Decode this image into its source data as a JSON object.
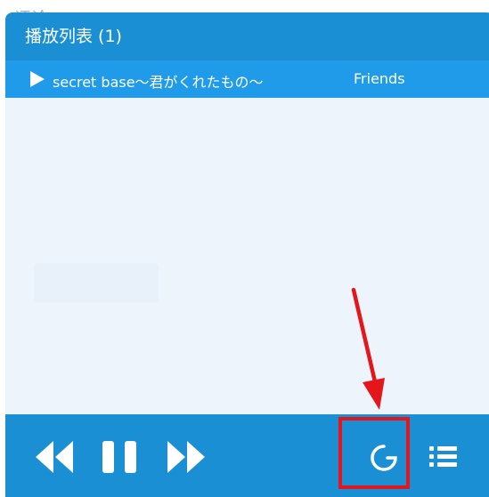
{
  "background": {
    "label": "评论"
  },
  "playlist": {
    "title": "播放列表 (1)",
    "tracks": [
      {
        "title": "secret base～君がくれたもの～",
        "artist": "Friends",
        "active": true
      }
    ]
  },
  "controls": {
    "icons": [
      "rewind-icon",
      "pause-icon",
      "fast-forward-icon",
      "loop-mode-icon",
      "playlist-icon"
    ]
  },
  "annotation": {
    "color": "#e4161c"
  },
  "colors": {
    "panel": "#1b8fd4",
    "active_row": "#1f9bea",
    "list_bg": "#eef4fc"
  }
}
